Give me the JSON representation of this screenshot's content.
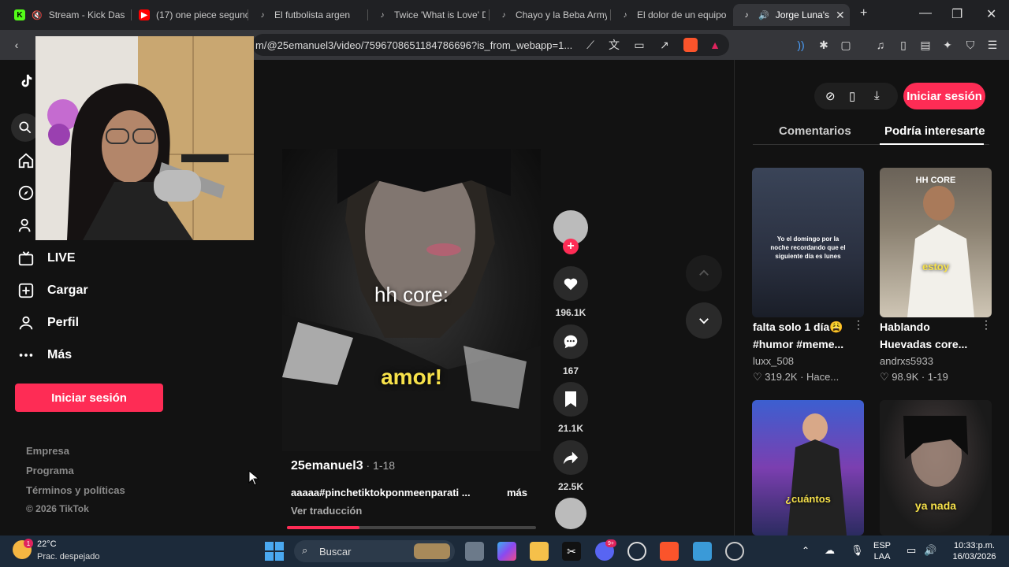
{
  "browser": {
    "tabs": [
      {
        "title": "Stream - Kick Das",
        "icon": "kick-icon",
        "color": "#53fc18"
      },
      {
        "title": "(17) one piece segunc",
        "icon": "youtube-icon",
        "color": "#ff0000"
      },
      {
        "title": "El futbolista argen",
        "icon": "tiktok-icon",
        "color": "#ffffff"
      },
      {
        "title": "Twice 'What is Love' D",
        "icon": "tiktok-icon",
        "color": "#ffffff"
      },
      {
        "title": "Chayo y la Beba Army",
        "icon": "tiktok-icon",
        "color": "#ffffff"
      },
      {
        "title": "El dolor de un equipo",
        "icon": "tiktok-icon",
        "color": "#ffffff"
      },
      {
        "title": "Jorge Luna's",
        "icon": "tiktok-icon",
        "color": "#ffffff",
        "active": true
      }
    ],
    "url": "m/@25emanuel3/video/7596708651184786696?is_from_webapp=1..."
  },
  "sidebar": {
    "items": [
      {
        "label": "LIVE",
        "icon": "live-icon"
      },
      {
        "label": "Cargar",
        "icon": "upload-icon"
      },
      {
        "label": "Perfil",
        "icon": "profile-icon"
      },
      {
        "label": "Más",
        "icon": "more-dots-icon"
      }
    ],
    "login_label": "Iniciar sesión",
    "footer": [
      "Empresa",
      "Programa",
      "Términos y políticas",
      "© 2026 TikTok"
    ]
  },
  "video": {
    "overlay_text_1": "hh core:",
    "overlay_text_2": "amor!",
    "author": "25emanuel3",
    "date": " · 1-18",
    "caption": "aaaaa#pinchetiktokponmeenparati ...",
    "more_label": "más",
    "translate_label": "Ver traducción",
    "progress": 0.29,
    "actions": {
      "likes": "196.1K",
      "comments": "167",
      "saves": "21.1K",
      "shares": "22.5K"
    }
  },
  "right_panel": {
    "login_label": "Iniciar sesión",
    "tabs": [
      "Comentarios",
      "Podría interesarte"
    ],
    "cards": [
      {
        "title": "falta solo 1 día😩 #humor #meme...",
        "user": "luxx_508",
        "meta": "319.2K · Hace...",
        "thumb_text": "Yo el domingo por la noche recordando que el siguiente día es lunes"
      },
      {
        "title": "Hablando Huevadas core...",
        "user": "andrxs5933",
        "meta": "98.9K · 1-19",
        "thumb_text": "estoy",
        "thumb_top": "HH CORE"
      },
      {
        "thumb_text": "¿cuántos"
      },
      {
        "thumb_text": "ya nada"
      }
    ]
  },
  "taskbar": {
    "weather_temp": "22°C",
    "weather_desc": "Prac. despejado",
    "search_placeholder": "Buscar",
    "lang1": "ESP",
    "lang2": "LAA",
    "time": "10:33:p.m.",
    "date": "16/03/2026",
    "weather_badge": "1",
    "discord_badge": "9+"
  }
}
